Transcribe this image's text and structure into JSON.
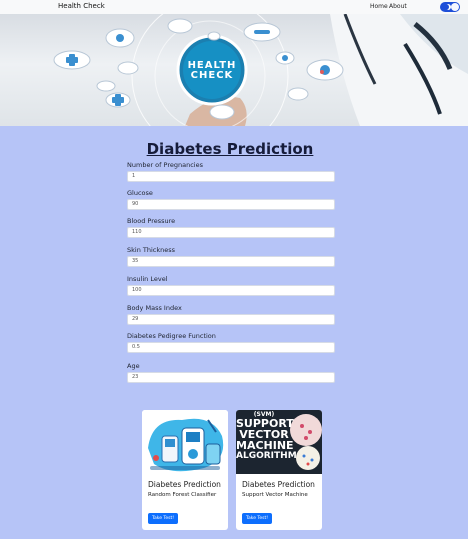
{
  "navbar": {
    "brand": "Health Check",
    "links": [
      "Home",
      "About"
    ]
  },
  "hero": {
    "title_line1": "HEALTH",
    "title_line2": "CHECK"
  },
  "page": {
    "title": "Diabetes Prediction"
  },
  "form": {
    "fields": [
      {
        "label": "Number of Pregnancies",
        "value": "1"
      },
      {
        "label": "Glucose",
        "value": "90"
      },
      {
        "label": "Blood Pressure",
        "value": "110"
      },
      {
        "label": "Skin Thickness",
        "value": "35"
      },
      {
        "label": "Insulin Level",
        "value": "100"
      },
      {
        "label": "Body Mass Index",
        "value": "29"
      },
      {
        "label": "Diabetes Pedigree Function",
        "value": "0.5"
      },
      {
        "label": "Age",
        "value": "23"
      }
    ]
  },
  "cards": [
    {
      "title": "Diabetes Prediction",
      "subtitle": "Random Forest Classifier",
      "button": "Take Test!"
    },
    {
      "title": "Diabetes Prediction",
      "subtitle": "Support Vector Machine",
      "button": "Take Test!",
      "image_text": [
        "(SVM)",
        "SUPPORT",
        "VECTOR",
        "MACHINE",
        "ALGORITHM"
      ]
    }
  ],
  "colors": {
    "page_bg": "#b6c4f7",
    "accent": "#0d6efd",
    "toggle": "#1e4fd8"
  }
}
